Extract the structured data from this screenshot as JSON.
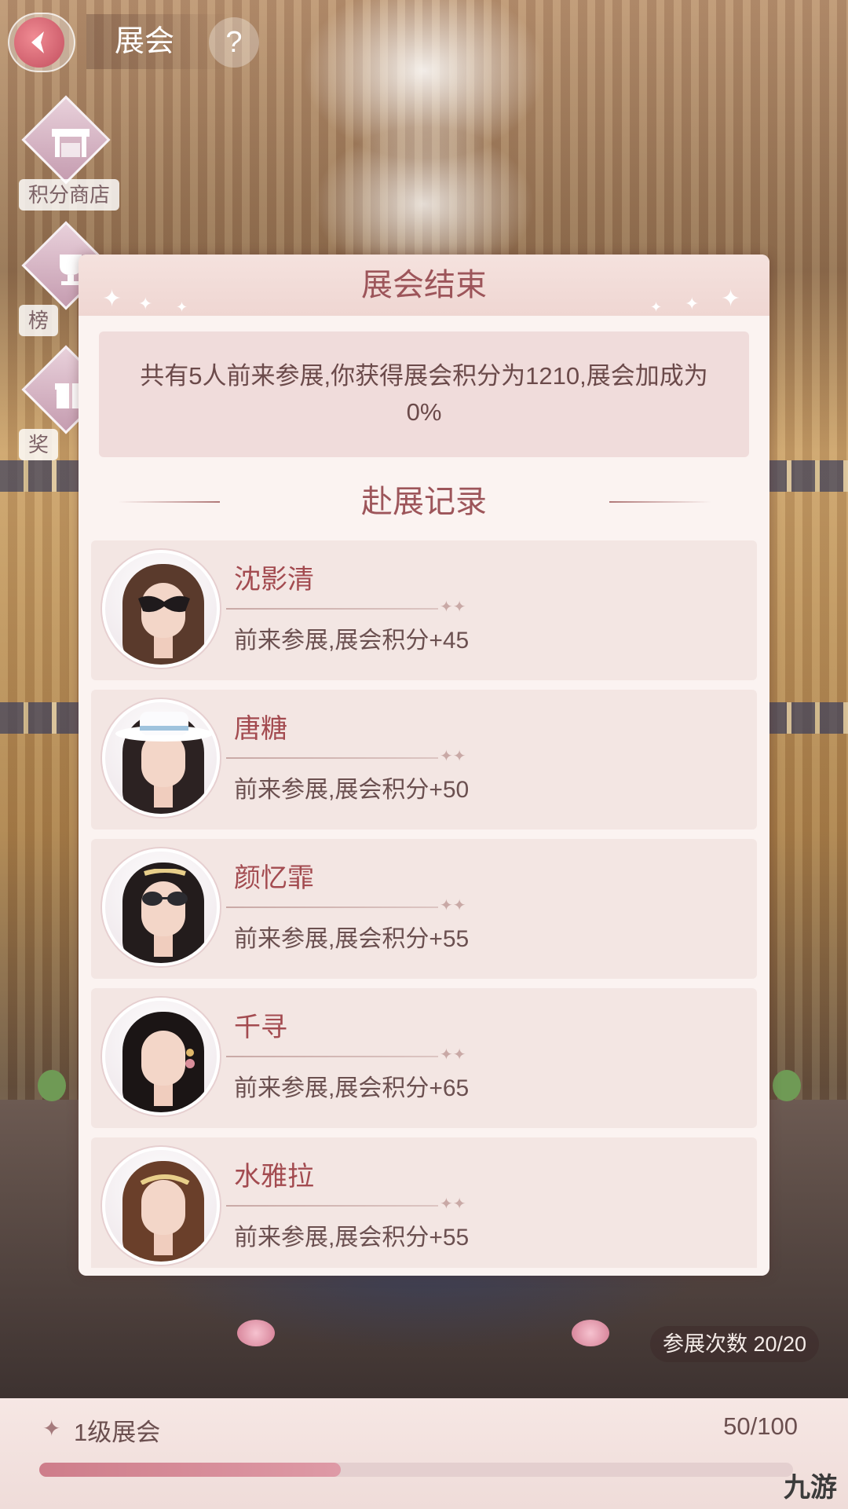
{
  "header": {
    "title": "展会",
    "help_label": "?"
  },
  "side_menu": [
    {
      "label": "积分商店",
      "icon": "shop-icon"
    },
    {
      "label": "榜",
      "icon": "trophy-icon"
    },
    {
      "label": "奖",
      "icon": "gift-icon"
    }
  ],
  "dialog": {
    "title": "展会结束",
    "summary": "共有5人前来参展,你获得展会积分为1210,展会加成为0%",
    "records_title": "赴展记录",
    "records": [
      {
        "name": "沈影清",
        "text": "前来参展,展会积分+45"
      },
      {
        "name": "唐糖",
        "text": "前来参展,展会积分+50"
      },
      {
        "name": "颜忆霏",
        "text": "前来参展,展会积分+55"
      },
      {
        "name": "千寻",
        "text": "前来参展,展会积分+65"
      },
      {
        "name": "水雅拉",
        "text": "前来参展,展会积分+55"
      }
    ]
  },
  "visits": {
    "label": "参展次数 20/20"
  },
  "level": {
    "label": "1级展会",
    "progress_text": "50/100",
    "progress_fraction": 0.4
  },
  "watermark": "九游",
  "colors": {
    "accent": "#a34b50",
    "title": "#9d555a",
    "progress": "#ce7d8a"
  }
}
